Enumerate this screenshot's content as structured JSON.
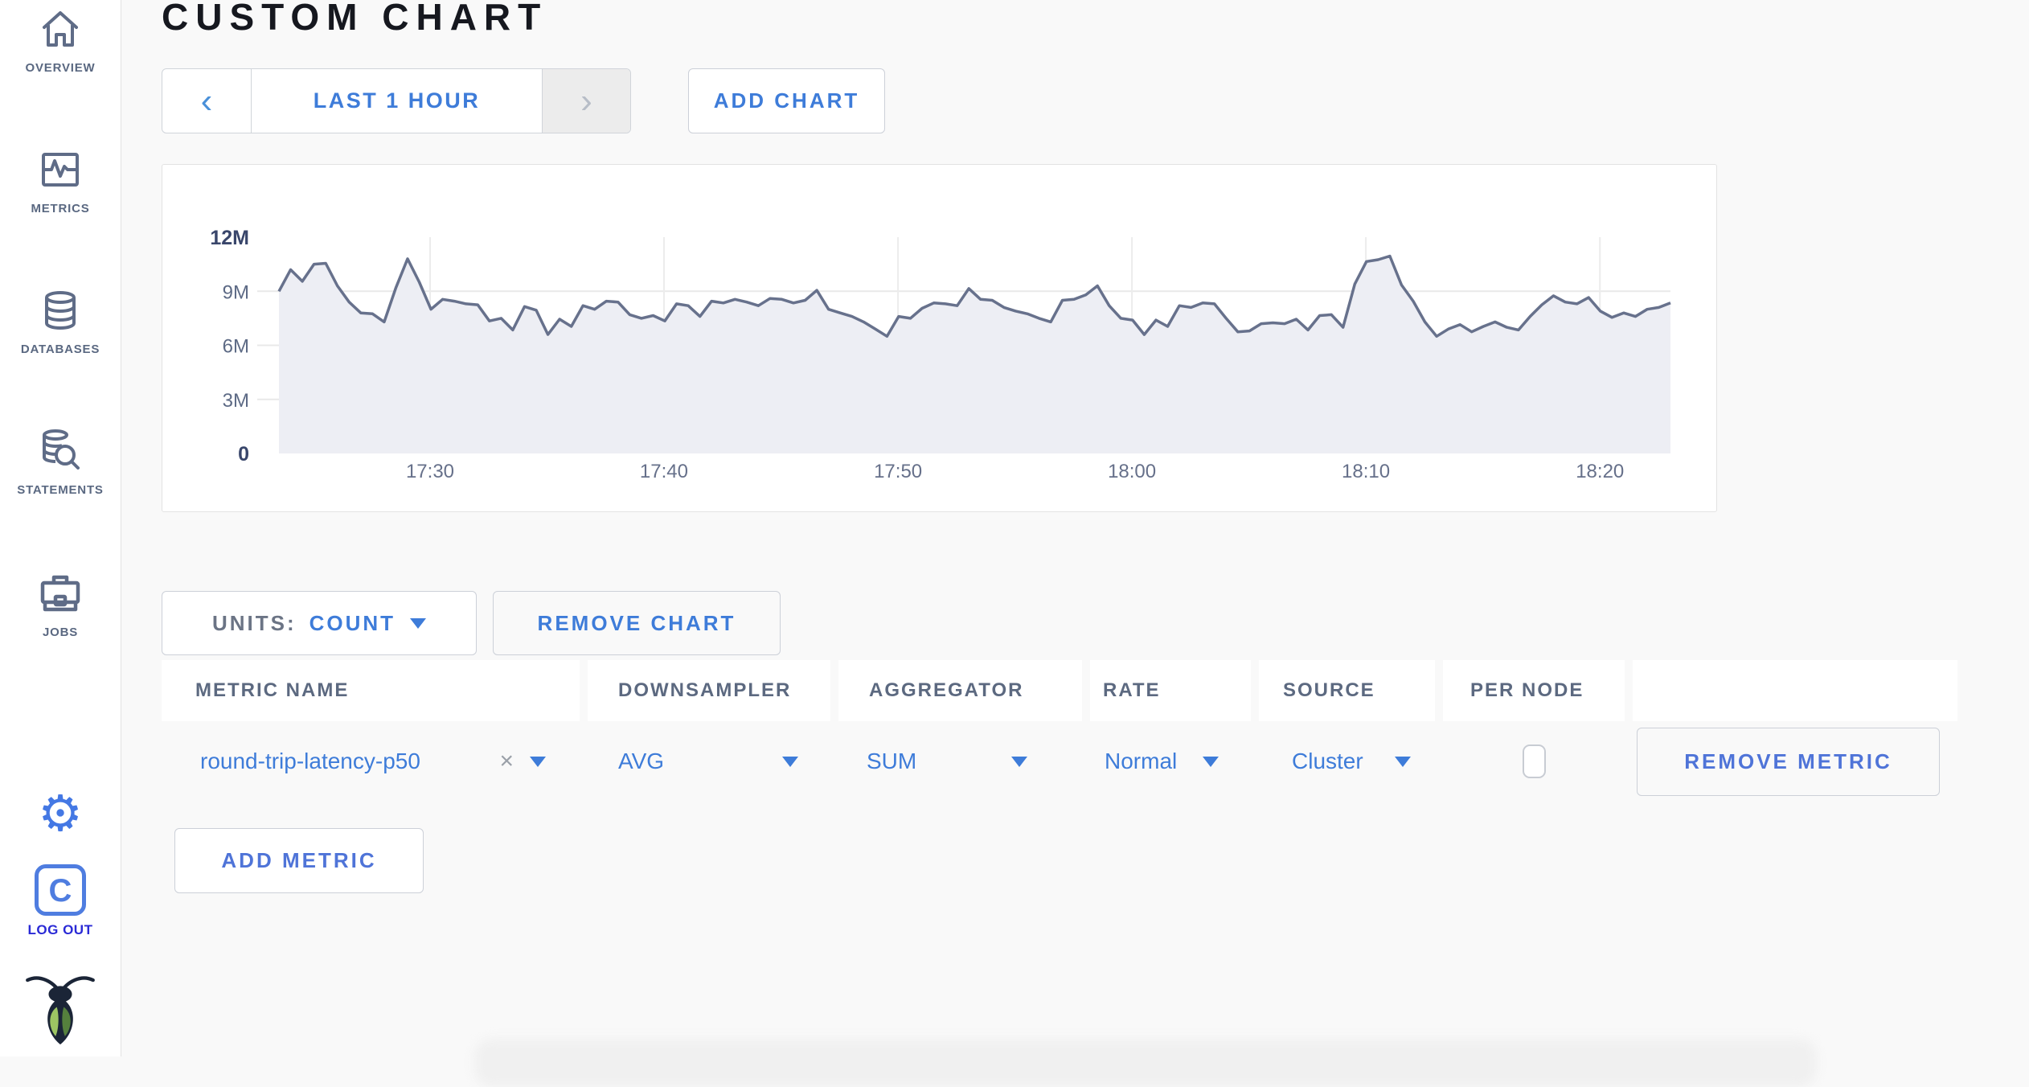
{
  "colors": {
    "accent_blue": "#3e7cd9",
    "secondary_blue": "#4f74d8",
    "logout_blue": "#2a2ad6",
    "sidebar_icon": "#5f6c87",
    "chart_line": "#67718c",
    "chart_fill": "#edeef4",
    "gridline": "#e9e9e9",
    "page_bg": "#f9f9f9"
  },
  "sidebar": {
    "items": [
      {
        "label": "OVERVIEW",
        "icon": "home-icon"
      },
      {
        "label": "METRICS",
        "icon": "metrics-icon"
      },
      {
        "label": "DATABASES",
        "icon": "database-icon"
      },
      {
        "label": "STATEMENTS",
        "icon": "statements-icon"
      },
      {
        "label": "JOBS",
        "icon": "jobs-icon"
      }
    ],
    "settings_icon": "gear-icon",
    "gear_glyph": "⚙",
    "logout": {
      "letter": "C",
      "label": "LOG OUT"
    },
    "logo": "cockroach-bug-logo"
  },
  "header": {
    "title": "CUSTOM CHART"
  },
  "toolbar": {
    "prev_glyph": "‹",
    "next_glyph": "›",
    "time_range_label": "LAST 1 HOUR",
    "add_chart_label": "ADD CHART"
  },
  "chart_controls": {
    "units_label": "UNITS:",
    "units_value": "COUNT",
    "remove_chart_label": "REMOVE CHART",
    "add_metric_label": "ADD METRIC",
    "remove_metric_label": "REMOVE METRIC",
    "close_glyph": "×"
  },
  "metrics_table": {
    "columns": [
      "METRIC NAME",
      "DOWNSAMPLER",
      "AGGREGATOR",
      "RATE",
      "SOURCE",
      "PER NODE"
    ],
    "rows": [
      {
        "metric_name": "round-trip-latency-p50",
        "downsampler": "AVG",
        "aggregator": "SUM",
        "rate": "Normal",
        "source": "Cluster",
        "per_node_checked": false
      }
    ]
  },
  "chart_data": {
    "type": "area",
    "title": "",
    "xlabel": "",
    "ylabel": "count",
    "ylim": [
      0,
      12000000
    ],
    "grid": true,
    "y_ticks": [
      {
        "value": 12,
        "label": "12M",
        "strong": true
      },
      {
        "value": 9,
        "label": "9M",
        "strong": false
      },
      {
        "value": 6,
        "label": "6M",
        "strong": false
      },
      {
        "value": 3,
        "label": "3M",
        "strong": false
      },
      {
        "value": 0,
        "label": "0",
        "strong": true
      }
    ],
    "x_ticks": [
      {
        "label": "17:30",
        "frac": 0.1086
      },
      {
        "label": "17:40",
        "frac": 0.2767
      },
      {
        "label": "17:50",
        "frac": 0.4449
      },
      {
        "label": "18:00",
        "frac": 0.613
      },
      {
        "label": "18:10",
        "frac": 0.7811
      },
      {
        "label": "18:20",
        "frac": 0.9493
      }
    ],
    "series": [
      {
        "name": "round-trip-latency-p50",
        "unit_scale": "millions",
        "values": [
          9.0,
          10.2,
          9.55,
          10.5,
          10.55,
          9.3,
          8.4,
          7.8,
          7.75,
          7.3,
          9.2,
          10.8,
          9.5,
          8.0,
          8.55,
          8.45,
          8.3,
          8.25,
          7.35,
          7.5,
          6.85,
          8.15,
          7.95,
          6.6,
          7.45,
          7.05,
          8.2,
          8.0,
          8.45,
          8.4,
          7.7,
          7.5,
          7.65,
          7.35,
          8.3,
          8.2,
          7.6,
          8.45,
          8.35,
          8.55,
          8.4,
          8.2,
          8.6,
          8.55,
          8.35,
          8.5,
          9.05,
          8.0,
          7.8,
          7.6,
          7.3,
          6.9,
          6.5,
          7.6,
          7.5,
          8.05,
          8.35,
          8.3,
          8.2,
          9.15,
          8.55,
          8.5,
          8.1,
          7.9,
          7.75,
          7.5,
          7.3,
          8.5,
          8.55,
          8.8,
          9.3,
          8.2,
          7.5,
          7.4,
          6.6,
          7.4,
          7.05,
          8.2,
          8.1,
          8.35,
          8.3,
          7.5,
          6.75,
          6.8,
          7.2,
          7.25,
          7.2,
          7.45,
          6.85,
          7.65,
          7.7,
          7.0,
          9.4,
          10.65,
          10.75,
          10.95,
          9.35,
          8.45,
          7.3,
          6.5,
          6.9,
          7.15,
          6.75,
          7.05,
          7.3,
          7.0,
          6.85,
          7.6,
          8.25,
          8.75,
          8.4,
          8.3,
          8.65,
          7.9,
          7.55,
          7.8,
          7.6,
          8.0,
          8.1,
          8.35
        ]
      }
    ]
  }
}
